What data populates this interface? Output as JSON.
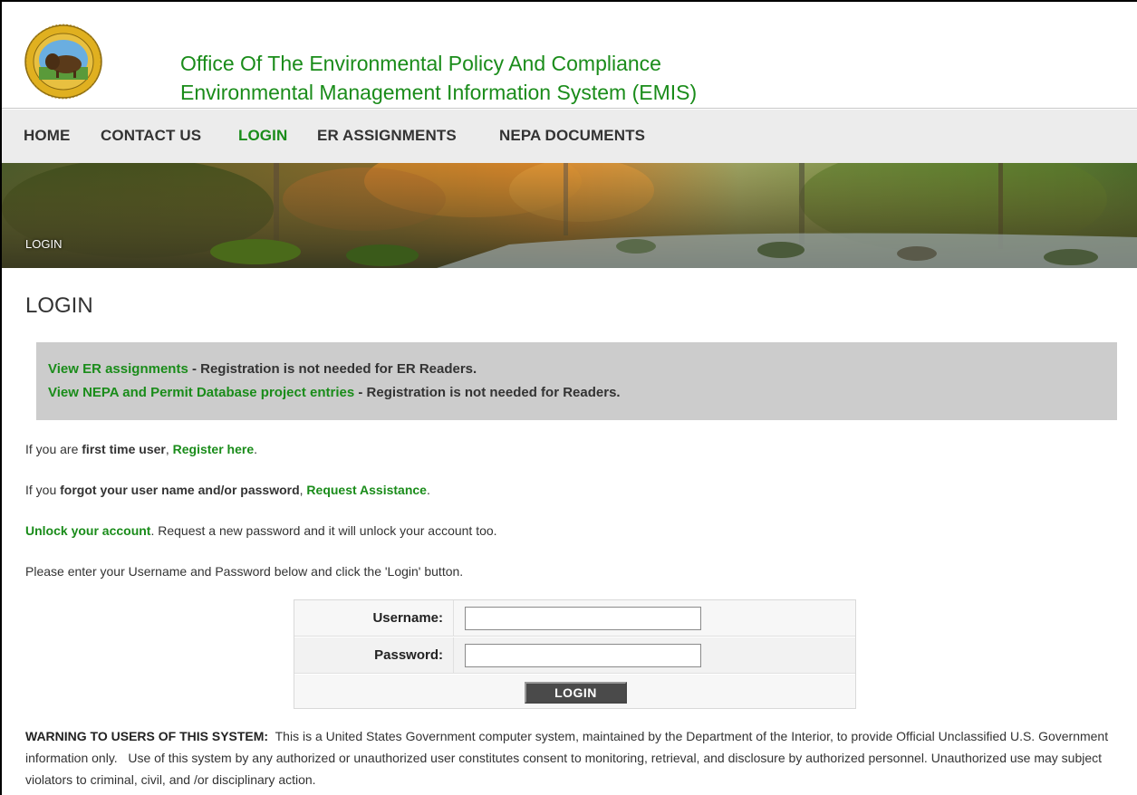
{
  "header": {
    "seal_alt": "U.S. Department of the Interior seal",
    "seal_text_top": "DEPARTMENT OF THE INTERIOR",
    "seal_text_bottom": "MARCH 3, 1849",
    "title_line1": "Office Of The Environmental Policy And Compliance",
    "title_line2": "Environmental Management Information System (EMIS)"
  },
  "nav": {
    "items": [
      {
        "label": "HOME"
      },
      {
        "label": "CONTACT US"
      },
      {
        "label": "LOGIN"
      },
      {
        "label": "ER ASSIGNMENTS"
      },
      {
        "label": "NEPA DOCUMENTS"
      }
    ],
    "active": "LOGIN"
  },
  "banner": {
    "label": "LOGIN"
  },
  "page": {
    "title": "LOGIN"
  },
  "notice": {
    "line1_link": "View ER assignments",
    "line1_text": " - Registration is not needed for ER Readers.",
    "line2_link": "View NEPA and Permit Database project entries",
    "line2_text": " - Registration is not needed for Readers."
  },
  "info": {
    "register_pre": "If you are ",
    "register_bold": "first time user",
    "register_sep": ", ",
    "register_link": "Register here",
    "register_end": ".",
    "forgot_pre": "If you ",
    "forgot_bold": "forgot your user name and/or password",
    "forgot_sep": ", ",
    "forgot_link": "Request Assistance",
    "forgot_end": ".",
    "unlock_link": "Unlock your account",
    "unlock_text": ". Request a new password and it will unlock your account too.",
    "instructions": "Please enter your Username and Password below and click the 'Login' button."
  },
  "login_form": {
    "username_label": "Username:",
    "username_value": "",
    "password_label": "Password:",
    "password_value": "",
    "button_label": "LOGIN"
  },
  "warning": {
    "heading": "WARNING TO USERS OF THIS SYSTEM:",
    "body": "  This is a United States Government computer system, maintained by the Department of the Interior, to provide Official Unclassified U.S. Government information only.   Use of this system by any authorized or unauthorized user constitutes consent to monitoring, retrieval, and disclosure by authorized personnel. Unauthorized use may subject violators to criminal, civil, and /or disciplinary action."
  },
  "colors": {
    "brand_green": "#1a8c1a",
    "nav_bg": "#ececec",
    "notice_bg": "#cccccc",
    "button_bg": "#4a4a4a"
  }
}
